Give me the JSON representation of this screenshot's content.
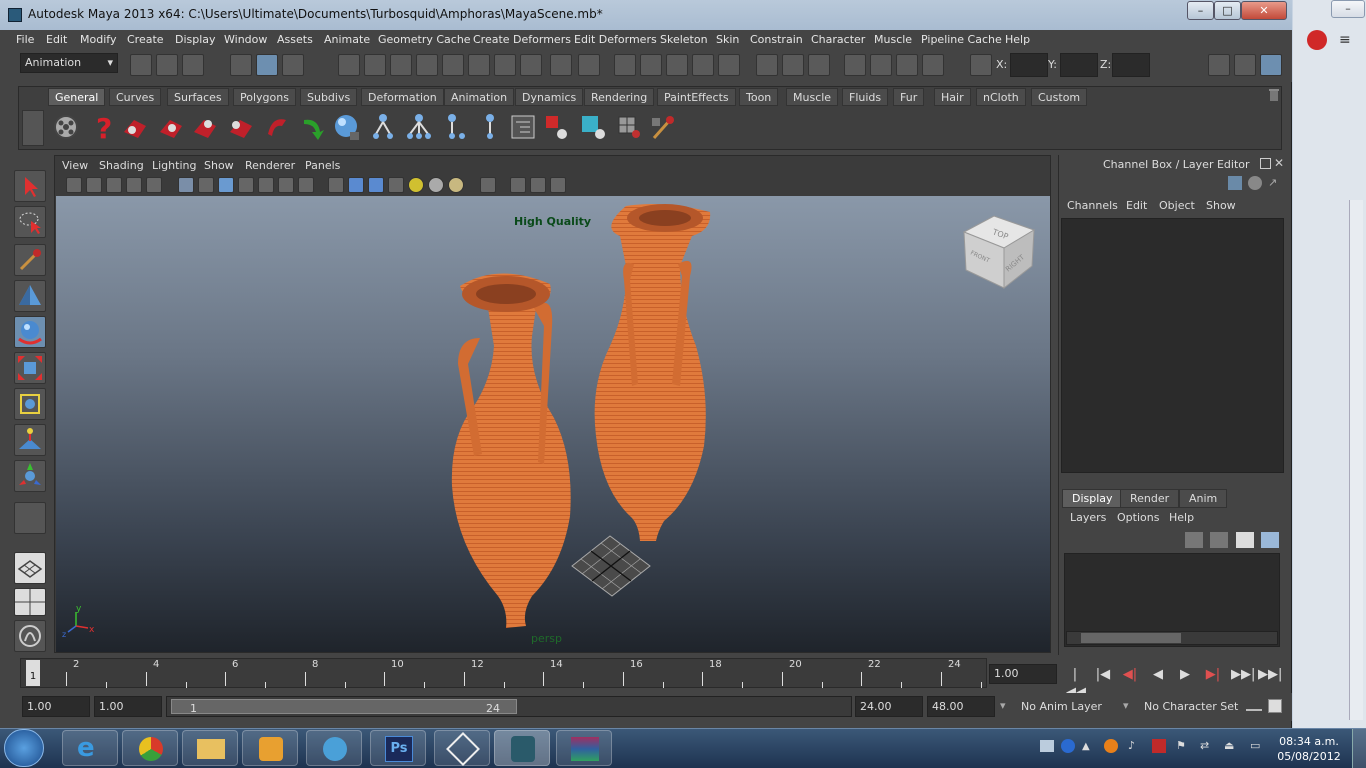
{
  "window": {
    "title": "Autodesk Maya 2013 x64: C:\\Users\\Ultimate\\Documents\\Turbosquid\\Amphoras\\MayaScene.mb*",
    "minimize": "–",
    "maximize": "□",
    "close": "✕"
  },
  "menu": [
    "File",
    "Edit",
    "Modify",
    "Create",
    "Display",
    "Window",
    "Assets",
    "Animate",
    "Geometry Cache",
    "Create Deformers",
    "Edit Deformers",
    "Skeleton",
    "Skin",
    "Constrain",
    "Character",
    "Muscle",
    "Pipeline Cache",
    "Help"
  ],
  "statusline": {
    "mode": "Animation",
    "x_label": "X:",
    "y_label": "Y:",
    "z_label": "Z:"
  },
  "shelf": {
    "tabs": [
      "General",
      "Curves",
      "Surfaces",
      "Polygons",
      "Subdivs",
      "Deformation",
      "Animation",
      "Dynamics",
      "Rendering",
      "PaintEffects",
      "Toon",
      "Muscle",
      "Fluids",
      "Fur",
      "Hair",
      "nCloth",
      "Custom"
    ],
    "active_tab": "General"
  },
  "panel": {
    "menu": [
      "View",
      "Shading",
      "Lighting",
      "Show",
      "Renderer",
      "Panels"
    ],
    "hud_quality": "High Quality",
    "camera_name": "persp",
    "viewcube_top": "TOP",
    "viewcube_front": "FRONT",
    "viewcube_right": "RIGHT",
    "axis_x": "x",
    "axis_y": "y",
    "axis_z": "z"
  },
  "channel_box": {
    "title": "Channel Box / Layer Editor",
    "menu": [
      "Channels",
      "Edit",
      "Object",
      "Show"
    ]
  },
  "layer_editor": {
    "tabs": [
      "Display",
      "Render",
      "Anim"
    ],
    "active_tab": "Display",
    "menu": [
      "Layers",
      "Options",
      "Help"
    ]
  },
  "timeline": {
    "ticks": [
      "1",
      "2",
      "4",
      "6",
      "8",
      "10",
      "12",
      "14",
      "16",
      "18",
      "20",
      "22",
      "24"
    ],
    "current_time": "1.00",
    "playback": [
      "|◀◀",
      "|◀",
      "◀|",
      "◀",
      "▶",
      "▶|",
      "▶▶|",
      "▶▶|"
    ]
  },
  "range": {
    "start": "1.00",
    "playback_start": "1.00",
    "slider_start": "1",
    "slider_end": "24",
    "playback_end": "24.00",
    "end": "48.00",
    "anim_layer": "No Anim Layer",
    "character_set": "No Character Set"
  },
  "taskbar": {
    "time": "08:34 a.m.",
    "date": "05/08/2012"
  },
  "colors": {
    "ui_bg": "#444444",
    "amphora": "#e07a3c",
    "hud_text": "#0a4a1a"
  }
}
